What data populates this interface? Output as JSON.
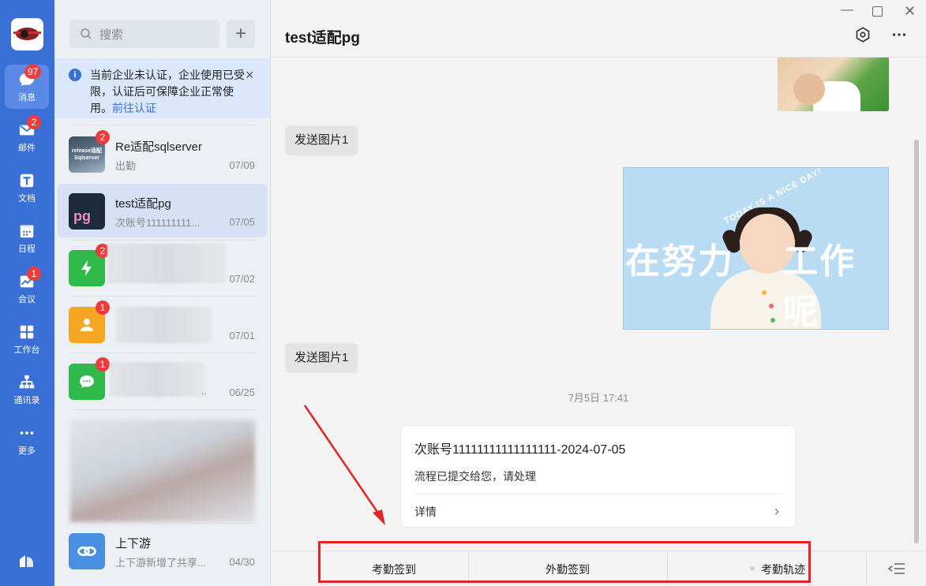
{
  "rail": {
    "items": [
      {
        "label": "消息",
        "icon": "chat-bubble-icon",
        "badge": "97",
        "active": true
      },
      {
        "label": "邮件",
        "icon": "mail-icon",
        "badge": "2"
      },
      {
        "label": "文档",
        "icon": "document-icon",
        "badge": ""
      },
      {
        "label": "日程",
        "icon": "calendar-icon",
        "badge": ""
      },
      {
        "label": "会议",
        "icon": "meeting-icon",
        "badge": "1"
      },
      {
        "label": "工作台",
        "icon": "workbench-icon",
        "badge": ""
      },
      {
        "label": "通讯录",
        "icon": "contacts-icon",
        "badge": ""
      },
      {
        "label": "更多",
        "icon": "more-icon",
        "badge": ""
      }
    ]
  },
  "search": {
    "placeholder": "搜索"
  },
  "notice": {
    "text": "当前企业未认证，企业使用已受限，认证后可保障企业正常使用。",
    "link": "前往认证"
  },
  "conversations": [
    {
      "name": "Re适配sqlserver",
      "preview": "出勤",
      "date": "07/09",
      "badge": "2",
      "avatar_text": "release适配 Sqlserver"
    },
    {
      "name": "test适配pg",
      "preview": "次账号111111111...",
      "date": "07/05",
      "badge": "",
      "avatar_text": "pg"
    },
    {
      "name": "",
      "preview": "",
      "date": "07/02",
      "badge": "2"
    },
    {
      "name": "",
      "preview": "",
      "date": "07/01",
      "badge": "1"
    },
    {
      "name": "",
      "preview": "..",
      "date": "06/25",
      "badge": "1"
    },
    {
      "name": "上下游",
      "preview": "上下游新增了共享...",
      "date": "04/30",
      "badge": ""
    }
  ],
  "chat": {
    "title": "test适配pg",
    "messages": [
      {
        "type": "text",
        "text": "发送图片1"
      },
      {
        "type": "image",
        "caption_left": "在努力",
        "caption_right": "工作呢",
        "arc_text": "TODAY IS A NICE DAY!"
      },
      {
        "type": "text",
        "text": "发送图片1"
      }
    ],
    "timestamp": "7月5日 17:41",
    "card": {
      "title": "次账号11111111111111111-2024-07-05",
      "desc": "流程已提交给您，请处理",
      "detail": "详情"
    },
    "toolbar": [
      {
        "label": "考勤签到"
      },
      {
        "label": "外勤签到"
      },
      {
        "label": "考勤轨迹"
      }
    ]
  },
  "colors": {
    "rail": "#3a6fd6",
    "badge": "#ef3b3b",
    "highlight": "#e02525",
    "link": "#3a6fd6"
  }
}
